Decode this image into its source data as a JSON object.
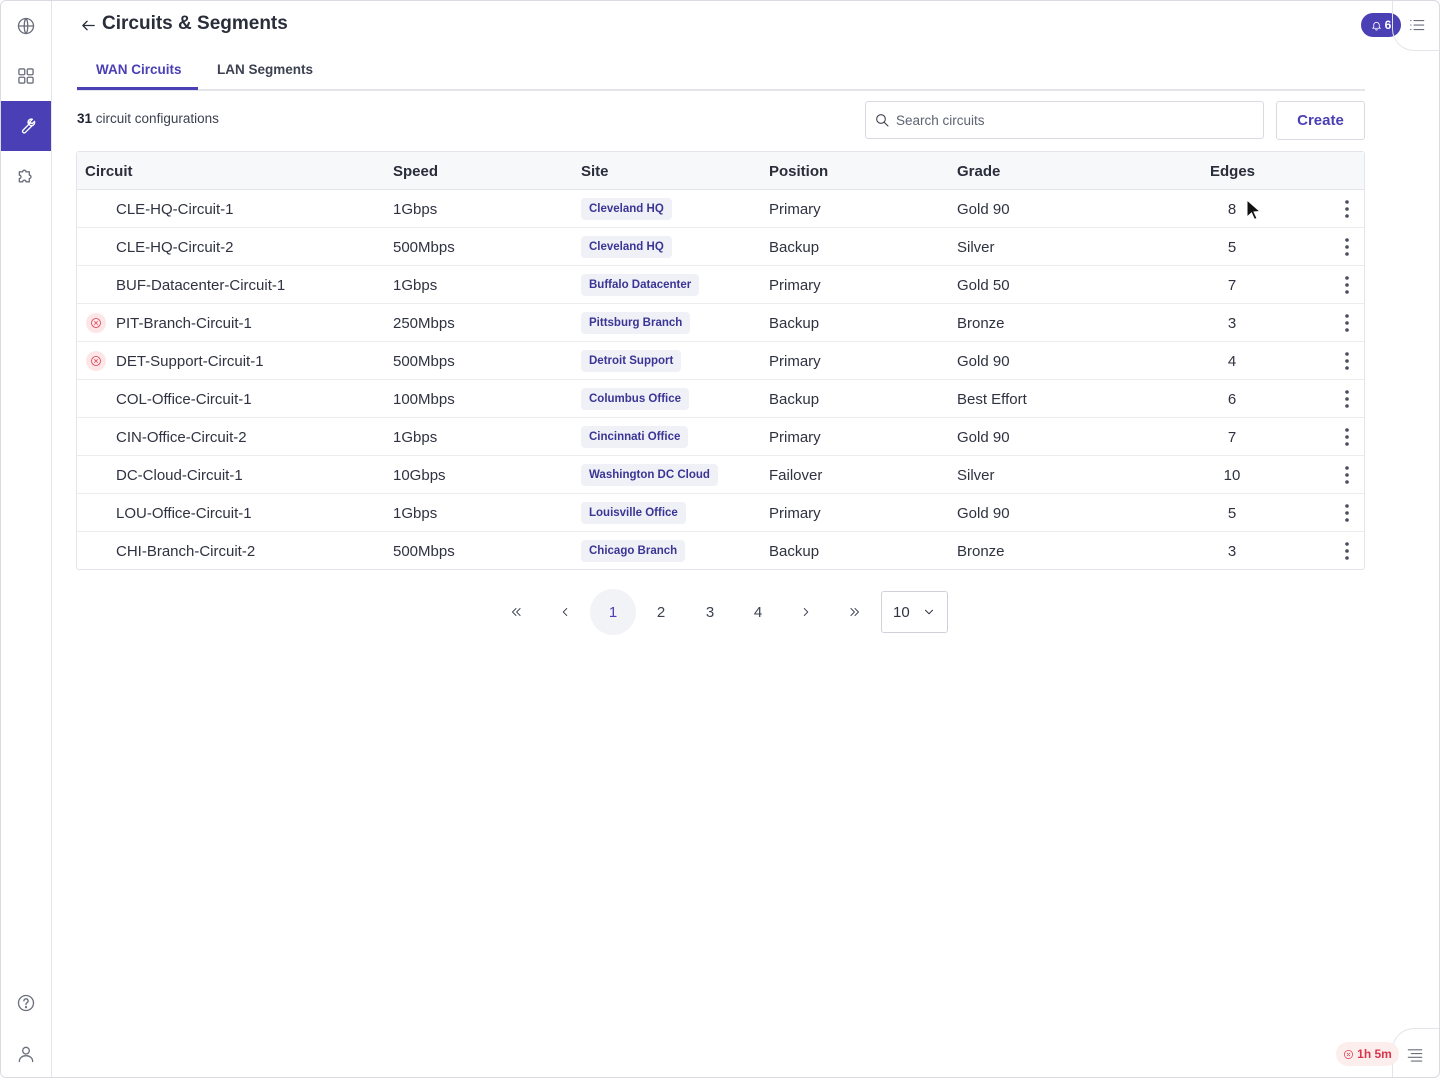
{
  "header": {
    "title": "Circuits & Segments",
    "notification_count": "6"
  },
  "tabs": [
    {
      "label": "WAN Circuits"
    },
    {
      "label": "LAN Segments"
    }
  ],
  "toolbar": {
    "count_number": "31",
    "count_text": "circuit configurations",
    "search_placeholder": "Search circuits",
    "create_label": "Create"
  },
  "table": {
    "columns": [
      "Circuit",
      "Speed",
      "Site",
      "Position",
      "Grade",
      "Edges"
    ],
    "rows": [
      {
        "circuit": "CLE-HQ-Circuit-1",
        "speed": "1Gbps",
        "site": "Cleveland HQ",
        "position": "Primary",
        "grade": "Gold 90",
        "edges": "8",
        "error": false
      },
      {
        "circuit": "CLE-HQ-Circuit-2",
        "speed": "500Mbps",
        "site": "Cleveland HQ",
        "position": "Backup",
        "grade": "Silver",
        "edges": "5",
        "error": false
      },
      {
        "circuit": "BUF-Datacenter-Circuit-1",
        "speed": "1Gbps",
        "site": "Buffalo Datacenter",
        "position": "Primary",
        "grade": "Gold 50",
        "edges": "7",
        "error": false
      },
      {
        "circuit": "PIT-Branch-Circuit-1",
        "speed": "250Mbps",
        "site": "Pittsburg Branch",
        "position": "Backup",
        "grade": "Bronze",
        "edges": "3",
        "error": true
      },
      {
        "circuit": "DET-Support-Circuit-1",
        "speed": "500Mbps",
        "site": "Detroit Support",
        "position": "Primary",
        "grade": "Gold 90",
        "edges": "4",
        "error": true
      },
      {
        "circuit": "COL-Office-Circuit-1",
        "speed": "100Mbps",
        "site": "Columbus Office",
        "position": "Backup",
        "grade": "Best Effort",
        "edges": "6",
        "error": false
      },
      {
        "circuit": "CIN-Office-Circuit-2",
        "speed": "1Gbps",
        "site": "Cincinnati Office",
        "position": "Primary",
        "grade": "Gold 90",
        "edges": "7",
        "error": false
      },
      {
        "circuit": "DC-Cloud-Circuit-1",
        "speed": "10Gbps",
        "site": "Washington DC Cloud",
        "position": "Failover",
        "grade": "Silver",
        "edges": "10",
        "error": false
      },
      {
        "circuit": "LOU-Office-Circuit-1",
        "speed": "1Gbps",
        "site": "Louisville Office",
        "position": "Primary",
        "grade": "Gold 90",
        "edges": "5",
        "error": false
      },
      {
        "circuit": "CHI-Branch-Circuit-2",
        "speed": "500Mbps",
        "site": "Chicago Branch",
        "position": "Backup",
        "grade": "Bronze",
        "edges": "3",
        "error": false
      }
    ]
  },
  "pagination": {
    "pages": [
      "1",
      "2",
      "3",
      "4"
    ],
    "current": "1",
    "page_size": "10"
  },
  "session": {
    "timer": "1h 5m"
  },
  "colors": {
    "accent": "#4a3fb5",
    "error": "#d9364b",
    "tag_bg": "#f0f1f6"
  },
  "icons": {
    "rail": [
      "globe-icon",
      "grid-icon",
      "wrench-icon",
      "puzzle-icon",
      "help-icon",
      "user-icon"
    ],
    "header": [
      "back-arrow-icon",
      "bell-icon",
      "list-menu-icon"
    ]
  }
}
